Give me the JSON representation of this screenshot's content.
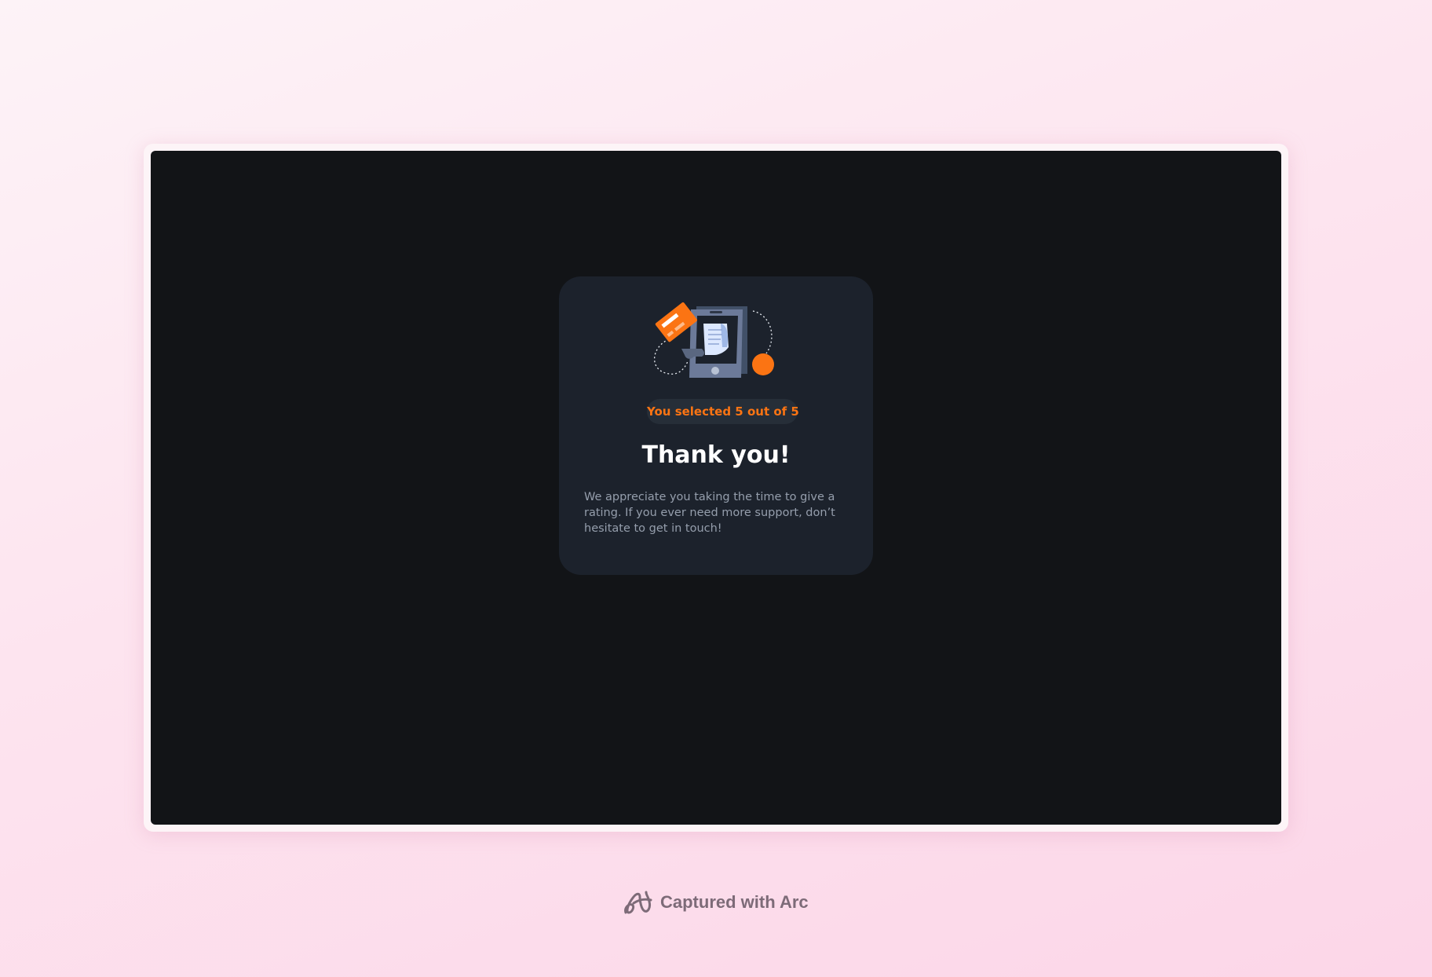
{
  "rating": {
    "selected_text": "You selected 5 out of 5",
    "selected": 5,
    "max": 5
  },
  "card": {
    "illustration": "payment-receipt-illustration",
    "title": "Thank you!",
    "message": "We appreciate you taking the time to give a rating. If you ever need more support, don’t hesitate to get in touch!"
  },
  "footer": {
    "logo_icon": "arc-logo-icon",
    "text": "Captured with Arc"
  },
  "colors": {
    "accent": "#fb7413",
    "card_bg": "#1c222c",
    "page_bg": "#121417",
    "text_muted": "#959eac"
  }
}
